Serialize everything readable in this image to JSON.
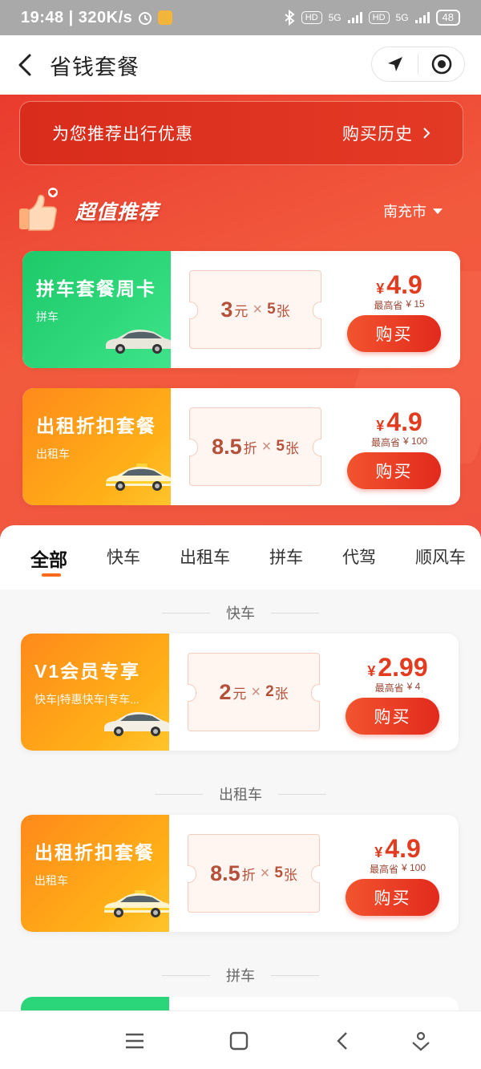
{
  "status_bar": {
    "time": "19:48",
    "net_speed": "320K/s",
    "hd1": "HD",
    "net1": "5G",
    "hd2": "HD",
    "net2": "5G",
    "battery": "48"
  },
  "header": {
    "title": "省钱套餐"
  },
  "promo": {
    "text": "为您推荐出行优惠",
    "link": "购买历史"
  },
  "recommend": {
    "title": "超值推荐",
    "city": "南充市"
  },
  "top_offers": [
    {
      "name": "拼车套餐周卡",
      "sub": "拼车",
      "coupon_value": "3",
      "coupon_unit": "元",
      "times": "×",
      "coupon_count": "5",
      "count_unit": "张",
      "currency": "¥",
      "price": "4.9",
      "save_label": "最高省",
      "save_value": "¥ 15",
      "buy": "购买"
    },
    {
      "name": "出租折扣套餐",
      "sub": "出租车",
      "coupon_value": "8.5",
      "coupon_unit": "折",
      "times": "×",
      "coupon_count": "5",
      "count_unit": "张",
      "currency": "¥",
      "price": "4.9",
      "save_label": "最高省",
      "save_value": "¥ 100",
      "buy": "购买"
    }
  ],
  "tabs": [
    "全部",
    "快车",
    "出租车",
    "拼车",
    "代驾",
    "顺风车"
  ],
  "sections": [
    {
      "label": "快车",
      "offer": {
        "name": "V1会员专享",
        "sub": "快车|特惠快车|专车...",
        "coupon_value": "2",
        "coupon_unit": "元",
        "times": "×",
        "coupon_count": "2",
        "count_unit": "张",
        "currency": "¥",
        "price": "2.99",
        "save_label": "最高省",
        "save_value": "¥ 4",
        "buy": "购买"
      }
    },
    {
      "label": "出租车",
      "offer": {
        "name": "出租折扣套餐",
        "sub": "出租车",
        "coupon_value": "8.5",
        "coupon_unit": "折",
        "times": "×",
        "coupon_count": "5",
        "count_unit": "张",
        "currency": "¥",
        "price": "4.9",
        "save_label": "最高省",
        "save_value": "¥ 100",
        "buy": "购买"
      }
    },
    {
      "label": "拼车"
    }
  ],
  "colors": {
    "hero_red": "#e93b2e",
    "accent_orange": "#ff6a1a",
    "price_red": "#e23b1f",
    "green_card": "#1ec96a",
    "orange_card": "#ffb018"
  }
}
